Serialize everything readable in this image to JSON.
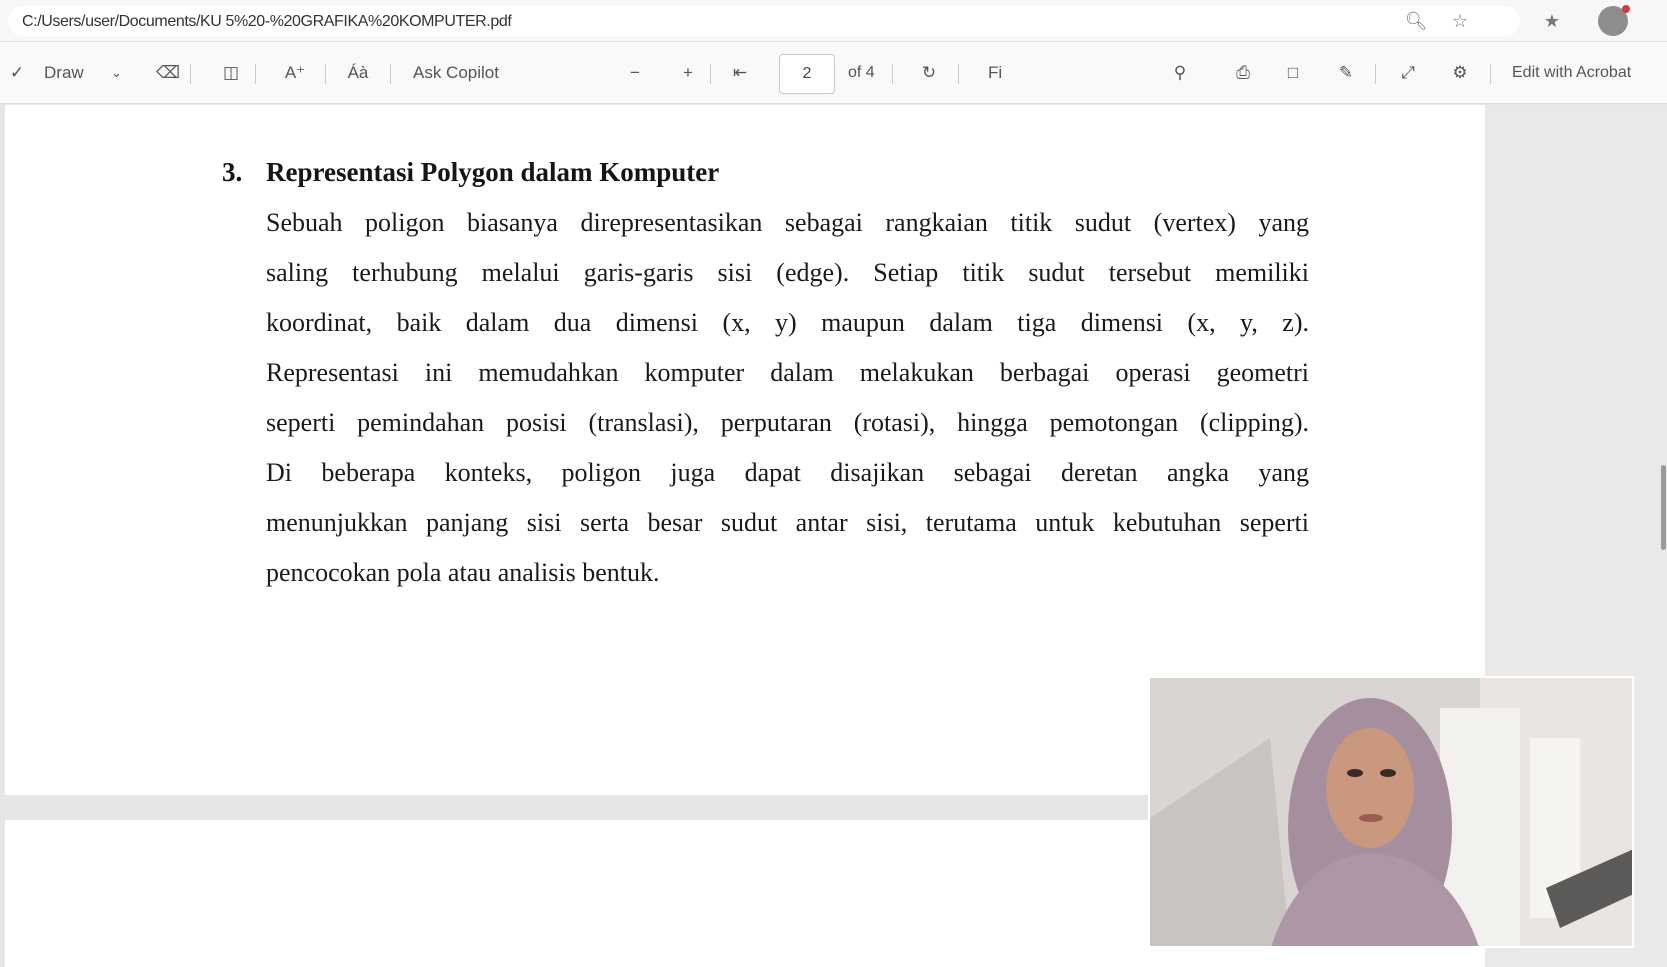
{
  "address_bar": {
    "url": "C:/Users/user/Documents/KU 5%20-%20GRAFIKA%20KOMPUTER.pdf"
  },
  "toolbar": {
    "draw_label": "Draw",
    "read_aloud_label": "Ask Copilot",
    "page_current": "2",
    "page_total": "of 4",
    "edit_with_acrobat_label": "Edit with Acrobat",
    "page_fit_label": "Fi"
  },
  "document": {
    "heading_number": "3.",
    "heading_title": "Representasi Polygon dalam Komputer",
    "body_lines": [
      "Sebuah poligon biasanya direpresentasikan sebagai rangkaian titik sudut (vertex) yang",
      "saling terhubung melalui garis-garis sisi (edge). Setiap titik sudut tersebut memiliki",
      "koordinat, baik dalam dua dimensi (x, y) maupun dalam tiga dimensi (x, y, z).",
      "Representasi ini memudahkan komputer dalam melakukan berbagai operasi geometri",
      "seperti pemindahan posisi (translasi), perputaran (rotasi), hingga pemotongan (clipping).",
      "Di beberapa konteks, poligon juga dapat disajikan sebagai deretan angka yang",
      "menunjukkan panjang sisi serta besar sudut antar sisi, terutama untuk kebutuhan seperti",
      "pencocokan pola atau analisis bentuk."
    ]
  },
  "icons": [
    "zoom-icon",
    "star-icon",
    "favorites-icon",
    "profile-avatar",
    "draw-icon",
    "eraser-icon",
    "view-icon",
    "text-icon",
    "read-aloud-icon",
    "first-page-icon",
    "last-page-icon",
    "rotate-icon",
    "search-icon",
    "print-icon",
    "save-icon",
    "save-as-icon",
    "fullscreen-icon",
    "settings-icon"
  ]
}
